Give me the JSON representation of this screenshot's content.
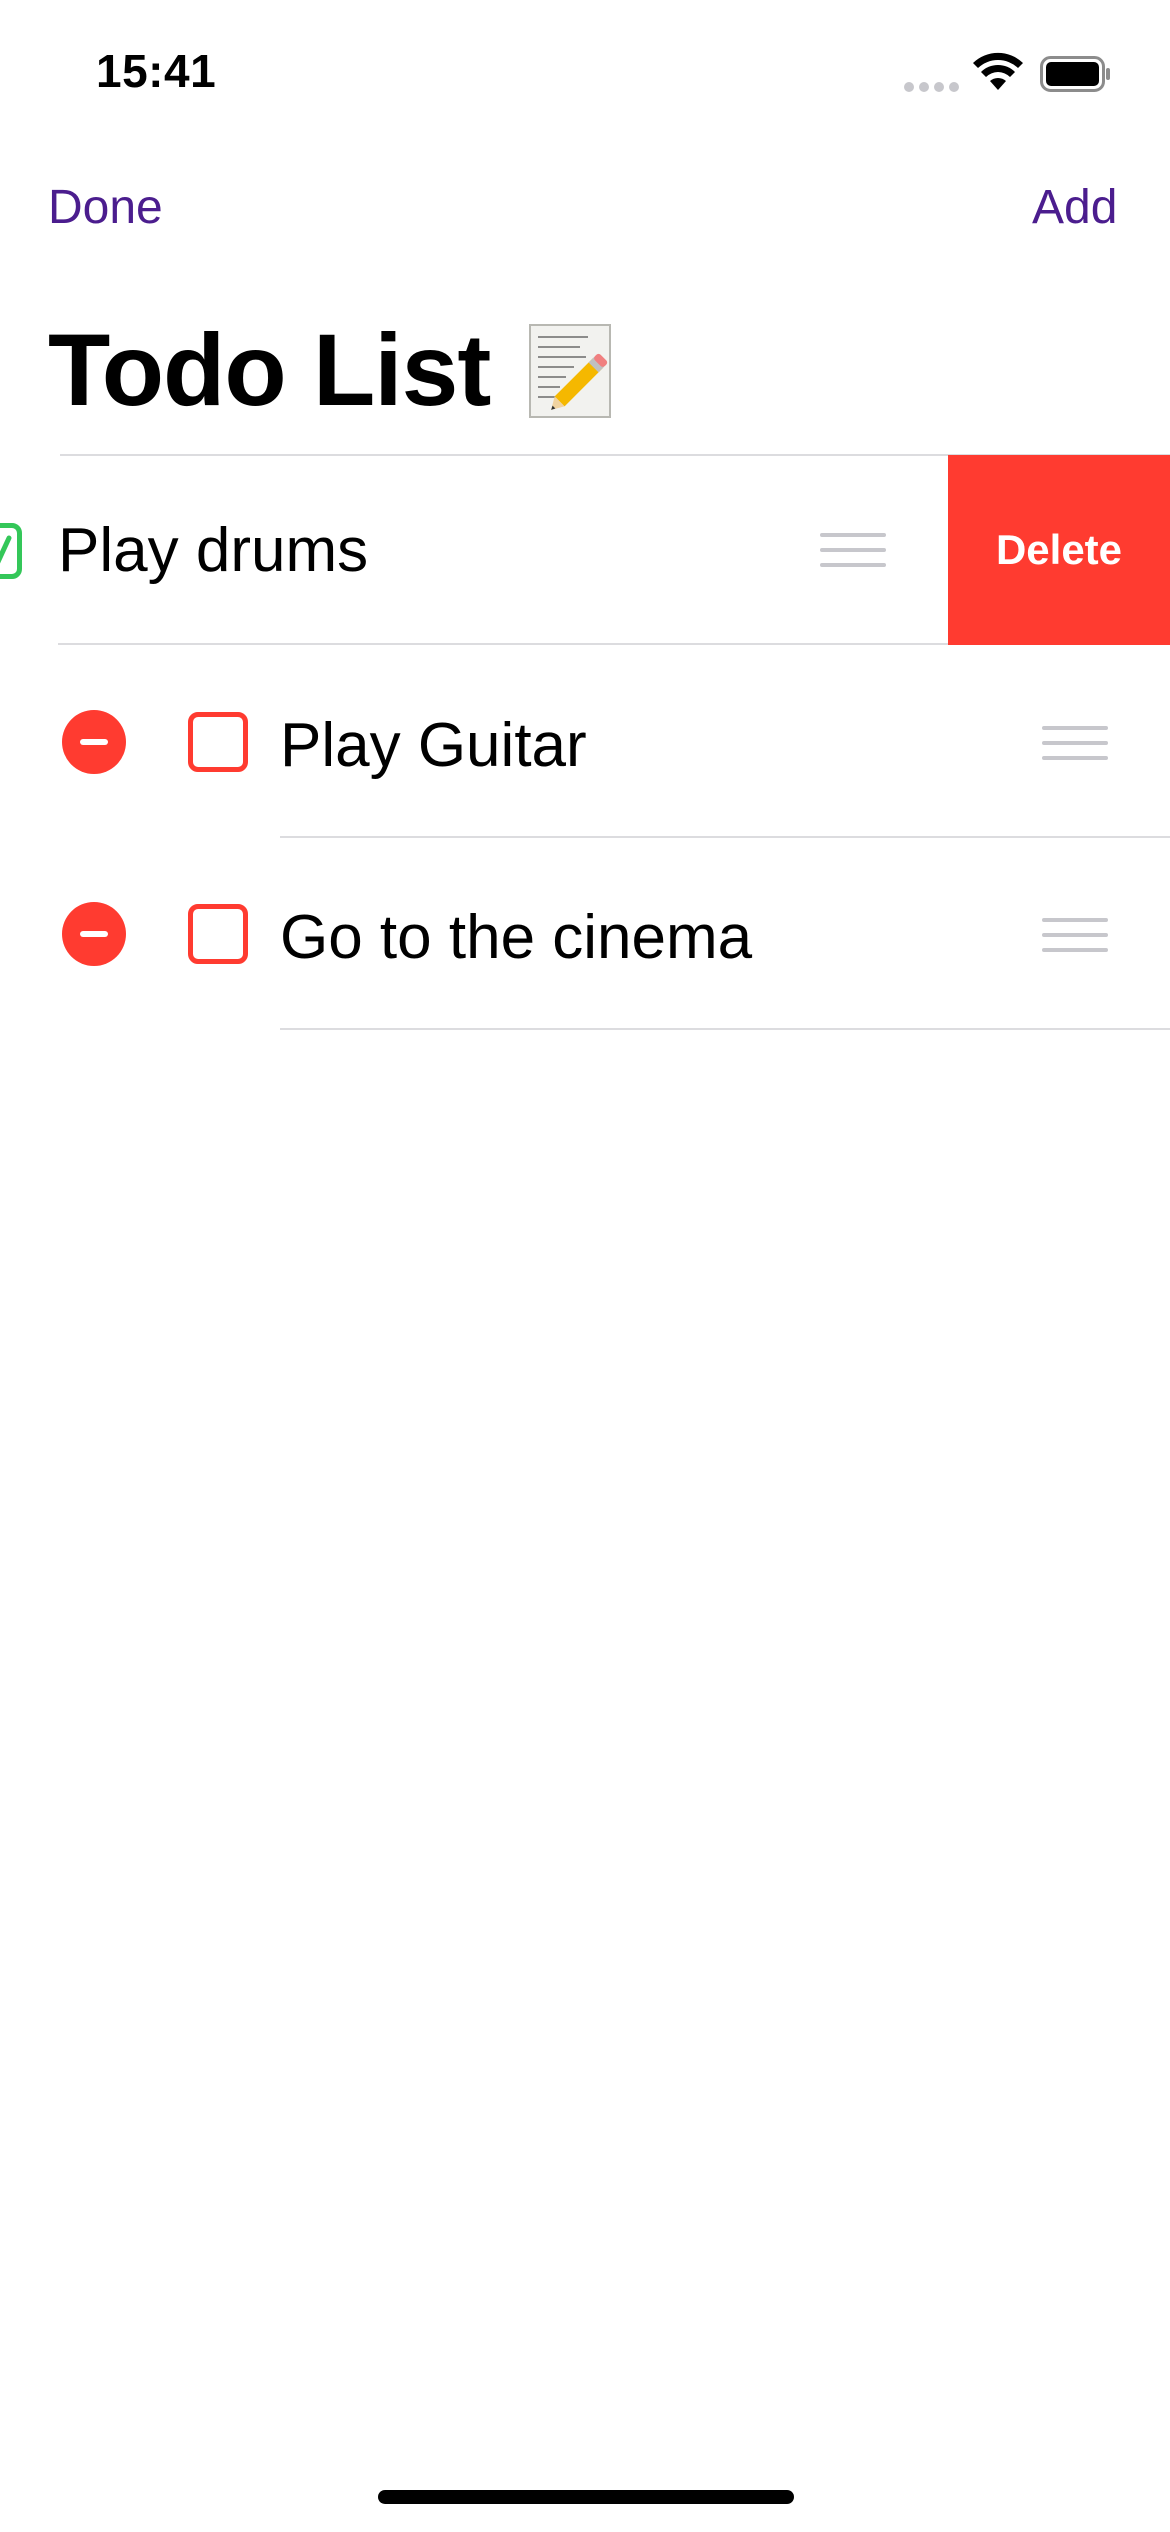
{
  "status_bar": {
    "time": "15:41"
  },
  "nav": {
    "done_label": "Done",
    "add_label": "Add"
  },
  "title": {
    "text": "Todo List",
    "icon": "memo-pencil-icon"
  },
  "swiped_item": {
    "label": "Play drums",
    "completed": true,
    "delete_action_label": "Delete"
  },
  "items": [
    {
      "label": "Play Guitar",
      "completed": false
    },
    {
      "label": "Go to the cinema",
      "completed": false
    }
  ],
  "colors": {
    "accent": "#4b1d8e",
    "destructive": "#ff3b30",
    "completed": "#34c759",
    "separator": "#dcdcdf",
    "handle": "#c7c7cc"
  }
}
